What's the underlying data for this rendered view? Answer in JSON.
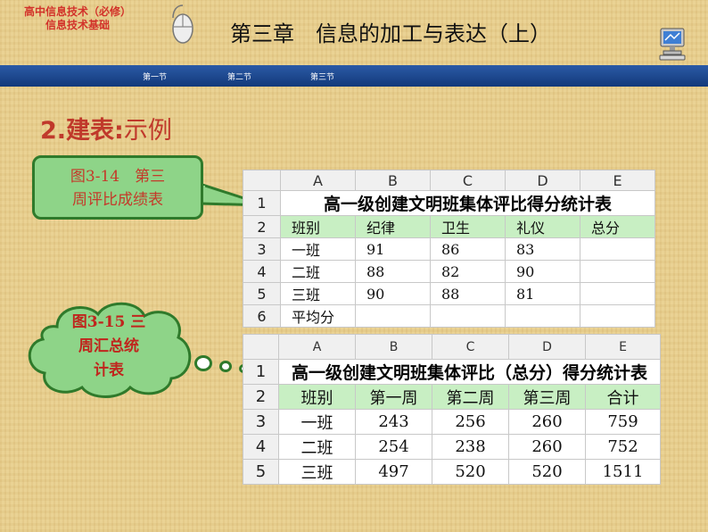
{
  "header": {
    "course_line1": "高中信息技术（必修）",
    "course_line2": "信息技术基础",
    "chapter_title": "第三章　信息的加工与表达（上）"
  },
  "nav": {
    "items": [
      "第一节",
      "第二节",
      "第三节"
    ]
  },
  "section": {
    "number_label": "2.建表:",
    "subtitle": "示例"
  },
  "callout1": {
    "line1": "图3-14　第三",
    "line2": "周评比成绩表"
  },
  "callout2": {
    "line1": "图3-15 三",
    "line2": "周汇总统",
    "line3": "计表"
  },
  "table1": {
    "column_headers": [
      "A",
      "B",
      "C",
      "D",
      "E"
    ],
    "row_numbers": [
      "1",
      "2",
      "3",
      "4",
      "5",
      "6"
    ],
    "title": "高一级创建文明班集体评比得分统计表",
    "header_row": [
      "班别",
      "纪律",
      "卫生",
      "礼仪",
      "总分"
    ],
    "rows": [
      [
        "一班",
        "91",
        "86",
        "83",
        ""
      ],
      [
        "二班",
        "88",
        "82",
        "90",
        ""
      ],
      [
        "三班",
        "90",
        "88",
        "81",
        ""
      ],
      [
        "平均分",
        "",
        "",
        "",
        ""
      ]
    ]
  },
  "table2": {
    "column_headers": [
      "A",
      "B",
      "C",
      "D",
      "E"
    ],
    "row_numbers": [
      "1",
      "2",
      "3",
      "4",
      "5"
    ],
    "title": "高一级创建文明班集体评比（总分）得分统计表",
    "header_row": [
      "班别",
      "第一周",
      "第二周",
      "第三周",
      "合计"
    ],
    "rows": [
      [
        "一班",
        "243",
        "256",
        "260",
        "759"
      ],
      [
        "二班",
        "254",
        "238",
        "260",
        "752"
      ],
      [
        "三班",
        "497",
        "520",
        "520",
        "1511"
      ]
    ]
  },
  "colors": {
    "nav_bar": "#1f4a92",
    "accent_red": "#c0392b",
    "callout_green": "#8ed488",
    "sheet_highlight": "#c8efc3"
  },
  "icons": [
    "mouse-icon",
    "computer-icon"
  ]
}
